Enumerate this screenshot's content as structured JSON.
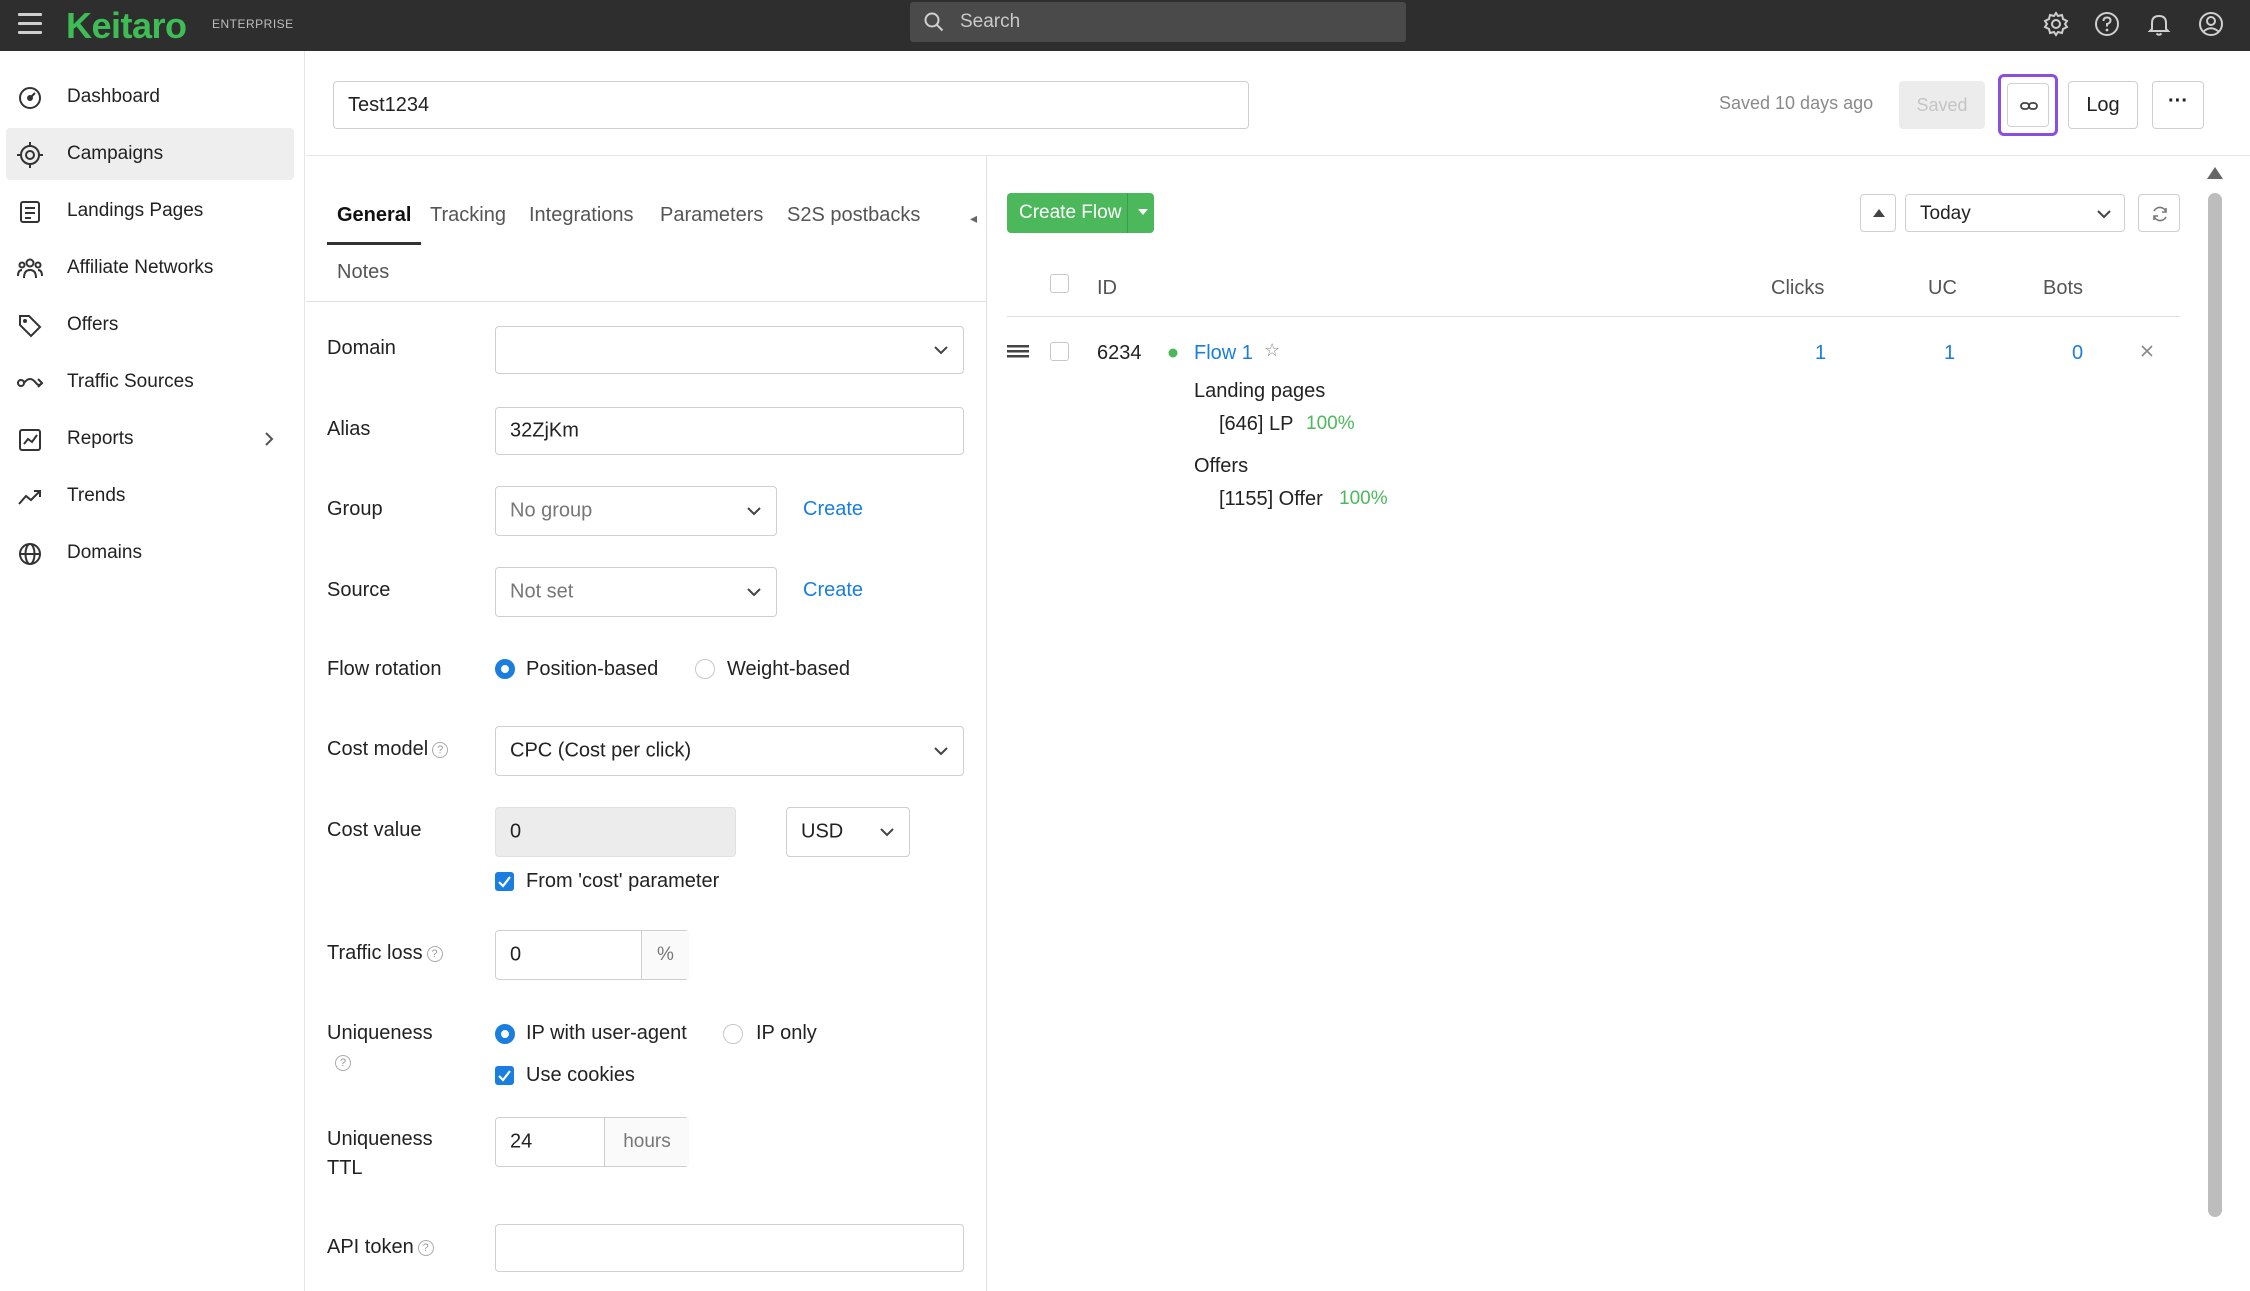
{
  "app": {
    "logo": "Keitaro",
    "edition": "ENTERPRISE",
    "search_placeholder": "Search",
    "top_icons": [
      "gear-icon",
      "help-icon",
      "bell-icon",
      "user-icon"
    ]
  },
  "sidebar": {
    "items": [
      {
        "label": "Dashboard",
        "icon": "dashboard-icon"
      },
      {
        "label": "Campaigns",
        "icon": "target-icon",
        "active": true
      },
      {
        "label": "Landings Pages",
        "icon": "landing-icon"
      },
      {
        "label": "Affiliate Networks",
        "icon": "network-icon"
      },
      {
        "label": "Offers",
        "icon": "tag-icon"
      },
      {
        "label": "Traffic Sources",
        "icon": "source-icon"
      },
      {
        "label": "Reports",
        "icon": "report-icon",
        "has_submenu": true
      },
      {
        "label": "Trends",
        "icon": "trend-icon"
      },
      {
        "label": "Domains",
        "icon": "globe-icon"
      }
    ]
  },
  "header": {
    "campaign_name": "Test1234",
    "saved_status": "Saved 10 days ago",
    "saved_button": "Saved",
    "log_button": "Log",
    "more_button": "···"
  },
  "tabs": [
    "General",
    "Tracking",
    "Integrations",
    "Parameters",
    "S2S postbacks",
    "Notes"
  ],
  "form": {
    "domain": {
      "label": "Domain",
      "value": ""
    },
    "alias": {
      "label": "Alias",
      "value": "32ZjKm"
    },
    "group": {
      "label": "Group",
      "value": "No group",
      "create": "Create"
    },
    "source": {
      "label": "Source",
      "value": "Not set",
      "create": "Create"
    },
    "flow_rotation": {
      "label": "Flow rotation",
      "options": [
        "Position-based",
        "Weight-based"
      ],
      "selected": "Position-based"
    },
    "cost_model": {
      "label": "Cost model",
      "value": "CPC (Cost per click)"
    },
    "cost_value": {
      "label": "Cost value",
      "value": "0",
      "currency": "USD",
      "from_param": "From 'cost' parameter",
      "from_param_checked": true
    },
    "traffic_loss": {
      "label": "Traffic loss",
      "value": "0",
      "unit": "%"
    },
    "uniqueness": {
      "label": "Uniqueness",
      "options": [
        "IP with user-agent",
        "IP only"
      ],
      "selected": "IP with user-agent",
      "cookies": "Use cookies",
      "cookies_checked": true
    },
    "uniqueness_ttl": {
      "label_1": "Uniqueness",
      "label_2": "TTL",
      "value": "24",
      "unit": "hours"
    },
    "api_token": {
      "label": "API token",
      "value": ""
    }
  },
  "flows": {
    "create_button": "Create Flow",
    "period": "Today",
    "columns": [
      "ID",
      "Clicks",
      "UC",
      "Bots"
    ],
    "rows": [
      {
        "id": "6234",
        "name": "Flow 1",
        "clicks": "1",
        "uc": "1",
        "bots": "0",
        "landings_title": "Landing pages",
        "landing": "[646] LP",
        "landing_pct": "100%",
        "offers_title": "Offers",
        "offer": "[1155] Offer",
        "offer_pct": "100%",
        "status_color": "#4cb85c"
      }
    ]
  },
  "colors": {
    "brand_green": "#3fbd55",
    "link_blue": "#1a7ee0",
    "highlight_purple": "#8a4fe0"
  }
}
